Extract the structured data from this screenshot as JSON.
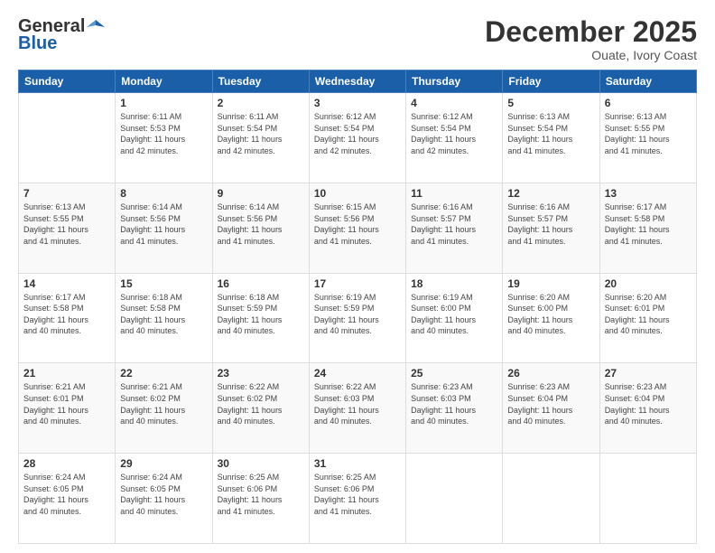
{
  "header": {
    "logo_general": "General",
    "logo_blue": "Blue",
    "title": "December 2025",
    "location": "Ouate, Ivory Coast"
  },
  "weekdays": [
    "Sunday",
    "Monday",
    "Tuesday",
    "Wednesday",
    "Thursday",
    "Friday",
    "Saturday"
  ],
  "weeks": [
    [
      {
        "day": "",
        "info": ""
      },
      {
        "day": "1",
        "info": "Sunrise: 6:11 AM\nSunset: 5:53 PM\nDaylight: 11 hours\nand 42 minutes."
      },
      {
        "day": "2",
        "info": "Sunrise: 6:11 AM\nSunset: 5:54 PM\nDaylight: 11 hours\nand 42 minutes."
      },
      {
        "day": "3",
        "info": "Sunrise: 6:12 AM\nSunset: 5:54 PM\nDaylight: 11 hours\nand 42 minutes."
      },
      {
        "day": "4",
        "info": "Sunrise: 6:12 AM\nSunset: 5:54 PM\nDaylight: 11 hours\nand 42 minutes."
      },
      {
        "day": "5",
        "info": "Sunrise: 6:13 AM\nSunset: 5:54 PM\nDaylight: 11 hours\nand 41 minutes."
      },
      {
        "day": "6",
        "info": "Sunrise: 6:13 AM\nSunset: 5:55 PM\nDaylight: 11 hours\nand 41 minutes."
      }
    ],
    [
      {
        "day": "7",
        "info": "Sunrise: 6:13 AM\nSunset: 5:55 PM\nDaylight: 11 hours\nand 41 minutes."
      },
      {
        "day": "8",
        "info": "Sunrise: 6:14 AM\nSunset: 5:56 PM\nDaylight: 11 hours\nand 41 minutes."
      },
      {
        "day": "9",
        "info": "Sunrise: 6:14 AM\nSunset: 5:56 PM\nDaylight: 11 hours\nand 41 minutes."
      },
      {
        "day": "10",
        "info": "Sunrise: 6:15 AM\nSunset: 5:56 PM\nDaylight: 11 hours\nand 41 minutes."
      },
      {
        "day": "11",
        "info": "Sunrise: 6:16 AM\nSunset: 5:57 PM\nDaylight: 11 hours\nand 41 minutes."
      },
      {
        "day": "12",
        "info": "Sunrise: 6:16 AM\nSunset: 5:57 PM\nDaylight: 11 hours\nand 41 minutes."
      },
      {
        "day": "13",
        "info": "Sunrise: 6:17 AM\nSunset: 5:58 PM\nDaylight: 11 hours\nand 41 minutes."
      }
    ],
    [
      {
        "day": "14",
        "info": "Sunrise: 6:17 AM\nSunset: 5:58 PM\nDaylight: 11 hours\nand 40 minutes."
      },
      {
        "day": "15",
        "info": "Sunrise: 6:18 AM\nSunset: 5:58 PM\nDaylight: 11 hours\nand 40 minutes."
      },
      {
        "day": "16",
        "info": "Sunrise: 6:18 AM\nSunset: 5:59 PM\nDaylight: 11 hours\nand 40 minutes."
      },
      {
        "day": "17",
        "info": "Sunrise: 6:19 AM\nSunset: 5:59 PM\nDaylight: 11 hours\nand 40 minutes."
      },
      {
        "day": "18",
        "info": "Sunrise: 6:19 AM\nSunset: 6:00 PM\nDaylight: 11 hours\nand 40 minutes."
      },
      {
        "day": "19",
        "info": "Sunrise: 6:20 AM\nSunset: 6:00 PM\nDaylight: 11 hours\nand 40 minutes."
      },
      {
        "day": "20",
        "info": "Sunrise: 6:20 AM\nSunset: 6:01 PM\nDaylight: 11 hours\nand 40 minutes."
      }
    ],
    [
      {
        "day": "21",
        "info": "Sunrise: 6:21 AM\nSunset: 6:01 PM\nDaylight: 11 hours\nand 40 minutes."
      },
      {
        "day": "22",
        "info": "Sunrise: 6:21 AM\nSunset: 6:02 PM\nDaylight: 11 hours\nand 40 minutes."
      },
      {
        "day": "23",
        "info": "Sunrise: 6:22 AM\nSunset: 6:02 PM\nDaylight: 11 hours\nand 40 minutes."
      },
      {
        "day": "24",
        "info": "Sunrise: 6:22 AM\nSunset: 6:03 PM\nDaylight: 11 hours\nand 40 minutes."
      },
      {
        "day": "25",
        "info": "Sunrise: 6:23 AM\nSunset: 6:03 PM\nDaylight: 11 hours\nand 40 minutes."
      },
      {
        "day": "26",
        "info": "Sunrise: 6:23 AM\nSunset: 6:04 PM\nDaylight: 11 hours\nand 40 minutes."
      },
      {
        "day": "27",
        "info": "Sunrise: 6:23 AM\nSunset: 6:04 PM\nDaylight: 11 hours\nand 40 minutes."
      }
    ],
    [
      {
        "day": "28",
        "info": "Sunrise: 6:24 AM\nSunset: 6:05 PM\nDaylight: 11 hours\nand 40 minutes."
      },
      {
        "day": "29",
        "info": "Sunrise: 6:24 AM\nSunset: 6:05 PM\nDaylight: 11 hours\nand 40 minutes."
      },
      {
        "day": "30",
        "info": "Sunrise: 6:25 AM\nSunset: 6:06 PM\nDaylight: 11 hours\nand 41 minutes."
      },
      {
        "day": "31",
        "info": "Sunrise: 6:25 AM\nSunset: 6:06 PM\nDaylight: 11 hours\nand 41 minutes."
      },
      {
        "day": "",
        "info": ""
      },
      {
        "day": "",
        "info": ""
      },
      {
        "day": "",
        "info": ""
      }
    ]
  ]
}
